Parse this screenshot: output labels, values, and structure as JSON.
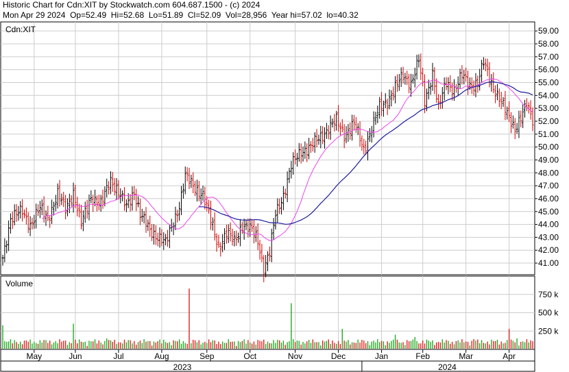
{
  "header": {
    "line1": "Historic Chart for Cdn:XIT by Stockwatch.com 604.687.1500 - (c) 2024",
    "line2": "Mon Apr 29 2024  Op=52.49  Hi=52.68  Lo=51.89  Cl=52.09  Vol=28,956  Year hi=57.02  lo=40.32"
  },
  "price_pane_label": "Cdn:XIT",
  "volume_pane_label": "Volume",
  "colors": {
    "up": "#000000",
    "down": "#cc0000",
    "vol_up": "#22aa22",
    "vol_down": "#dd2222",
    "ma_short": "#ee44ee",
    "ma_long": "#1a1aa0",
    "grid": "#cccccc"
  },
  "chart_data": {
    "type": "line",
    "series": [],
    "price_axis": {
      "ylim": [
        40.1,
        59.7
      ],
      "ticks": [
        "41.00",
        "42.00",
        "43.00",
        "44.00",
        "45.00",
        "46.00",
        "47.00",
        "48.00",
        "49.00",
        "50.00",
        "51.00",
        "52.00",
        "53.00",
        "54.00",
        "55.00",
        "56.00",
        "57.00",
        "58.00",
        "59.00"
      ]
    },
    "volume_axis": {
      "ylim": [
        0,
        1000000
      ],
      "ticks": [
        {
          "value": 250000,
          "label": "250 k"
        },
        {
          "value": 500000,
          "label": "500 k"
        },
        {
          "value": 750000,
          "label": "750 k"
        }
      ]
    },
    "x_months": [
      {
        "label": "May",
        "index": 16
      },
      {
        "label": "Jun",
        "index": 37
      },
      {
        "label": "Jul",
        "index": 59
      },
      {
        "label": "Aug",
        "index": 81
      },
      {
        "label": "Sep",
        "index": 104
      },
      {
        "label": "Oct",
        "index": 126
      },
      {
        "label": "Nov",
        "index": 149
      },
      {
        "label": "Dec",
        "index": 171
      },
      {
        "label": "Jan",
        "index": 193
      },
      {
        "label": "Feb",
        "index": 214
      },
      {
        "label": "Mar",
        "index": 236
      },
      {
        "label": "Apr",
        "index": 258
      }
    ],
    "x_years": [
      {
        "label": "2023",
        "from": 0,
        "to": 183
      },
      {
        "label": "2024",
        "from": 183,
        "to": 270
      }
    ],
    "anchors": [
      {
        "i": 0,
        "c": 41.4
      },
      {
        "i": 4,
        "c": 44.5
      },
      {
        "i": 10,
        "c": 45.0
      },
      {
        "i": 14,
        "c": 44.0
      },
      {
        "i": 19,
        "c": 45.2
      },
      {
        "i": 23,
        "c": 44.5
      },
      {
        "i": 28,
        "c": 46.3
      },
      {
        "i": 32,
        "c": 45.2
      },
      {
        "i": 36,
        "c": 46.5
      },
      {
        "i": 40,
        "c": 44.0
      },
      {
        "i": 45,
        "c": 46.2
      },
      {
        "i": 50,
        "c": 45.5
      },
      {
        "i": 55,
        "c": 47.5
      },
      {
        "i": 58,
        "c": 46.8
      },
      {
        "i": 63,
        "c": 45.3
      },
      {
        "i": 67,
        "c": 46.6
      },
      {
        "i": 70,
        "c": 44.8
      },
      {
        "i": 75,
        "c": 43.5
      },
      {
        "i": 80,
        "c": 43.0
      },
      {
        "i": 83,
        "c": 42.5
      },
      {
        "i": 87,
        "c": 44.2
      },
      {
        "i": 90,
        "c": 45.5
      },
      {
        "i": 93,
        "c": 47.7
      },
      {
        "i": 97,
        "c": 47.0
      },
      {
        "i": 102,
        "c": 46.3
      },
      {
        "i": 106,
        "c": 44.3
      },
      {
        "i": 110,
        "c": 42.3
      },
      {
        "i": 114,
        "c": 43.3
      },
      {
        "i": 118,
        "c": 42.7
      },
      {
        "i": 122,
        "c": 44.0
      },
      {
        "i": 127,
        "c": 43.5
      },
      {
        "i": 130,
        "c": 42.8
      },
      {
        "i": 133,
        "c": 40.6
      },
      {
        "i": 136,
        "c": 41.8
      },
      {
        "i": 139,
        "c": 44.8
      },
      {
        "i": 143,
        "c": 46.3
      },
      {
        "i": 147,
        "c": 48.5
      },
      {
        "i": 152,
        "c": 49.7
      },
      {
        "i": 157,
        "c": 50.0
      },
      {
        "i": 162,
        "c": 50.8
      },
      {
        "i": 166,
        "c": 51.5
      },
      {
        "i": 170,
        "c": 52.0
      },
      {
        "i": 174,
        "c": 51.0
      },
      {
        "i": 179,
        "c": 51.8
      },
      {
        "i": 184,
        "c": 49.8
      },
      {
        "i": 188,
        "c": 51.5
      },
      {
        "i": 192,
        "c": 53.0
      },
      {
        "i": 196,
        "c": 53.6
      },
      {
        "i": 200,
        "c": 54.6
      },
      {
        "i": 204,
        "c": 55.5
      },
      {
        "i": 208,
        "c": 55.0
      },
      {
        "i": 212,
        "c": 56.7
      },
      {
        "i": 215,
        "c": 53.5
      },
      {
        "i": 219,
        "c": 55.8
      },
      {
        "i": 222,
        "c": 53.0
      },
      {
        "i": 226,
        "c": 55.0
      },
      {
        "i": 230,
        "c": 54.5
      },
      {
        "i": 234,
        "c": 55.5
      },
      {
        "i": 238,
        "c": 54.8
      },
      {
        "i": 242,
        "c": 55.0
      },
      {
        "i": 245,
        "c": 56.5
      },
      {
        "i": 249,
        "c": 55.0
      },
      {
        "i": 253,
        "c": 53.8
      },
      {
        "i": 257,
        "c": 52.5
      },
      {
        "i": 261,
        "c": 51.5
      },
      {
        "i": 264,
        "c": 52.3
      },
      {
        "i": 267,
        "c": 53.2
      },
      {
        "i": 270,
        "c": 52.09
      }
    ],
    "volume_spikes": [
      {
        "i": 0,
        "v": 330000
      },
      {
        "i": 11,
        "v": 120000
      },
      {
        "i": 36,
        "v": 350000
      },
      {
        "i": 53,
        "v": 150000
      },
      {
        "i": 95,
        "v": 830000
      },
      {
        "i": 113,
        "v": 90000
      },
      {
        "i": 147,
        "v": 630000
      },
      {
        "i": 155,
        "v": 110000
      },
      {
        "i": 173,
        "v": 280000
      },
      {
        "i": 200,
        "v": 200000
      },
      {
        "i": 210,
        "v": 170000
      },
      {
        "i": 240,
        "v": 140000
      },
      {
        "i": 258,
        "v": 280000
      },
      {
        "i": 262,
        "v": 150000
      }
    ]
  }
}
